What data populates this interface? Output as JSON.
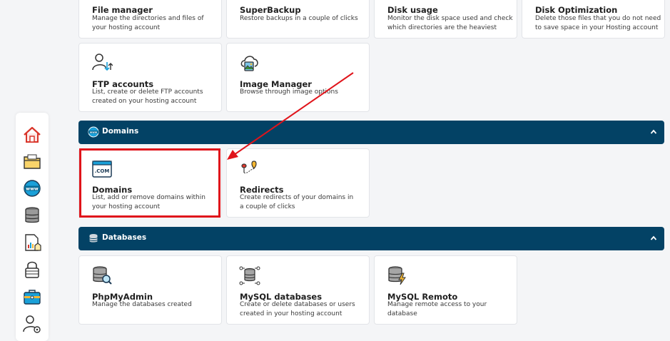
{
  "top_row": [
    {
      "title": "File manager",
      "desc": "Manage the directories and files of your hosting account",
      "icon": "folder-icon"
    },
    {
      "title": "SuperBackup",
      "desc": "Restore backups in a couple of clicks",
      "icon": "backup-icon"
    },
    {
      "title": "Disk usage",
      "desc": "Monitor the disk space used and check which directories are the heaviest",
      "icon": "disk-icon"
    },
    {
      "title": "Disk Optimization",
      "desc": "Delete those files that you do not need to save space in your Hosting account",
      "icon": "optimize-icon"
    }
  ],
  "files_row2": [
    {
      "title": "FTP accounts",
      "desc": "List, create or delete FTP accounts created on your hosting account",
      "icon": "ftp-user-icon"
    },
    {
      "title": "Image Manager",
      "desc": "Browse through image options",
      "icon": "image-cloud-icon"
    }
  ],
  "sections": {
    "domains": {
      "title": "Domains",
      "icon": "www-globe-icon"
    },
    "databases": {
      "title": "Databases",
      "icon": "database-icon"
    }
  },
  "domains_cards": [
    {
      "title": "Domains",
      "desc": "List, add or remove domains within your hosting account",
      "icon": "dot-com-browser-icon",
      "icon_text": ".COM"
    },
    {
      "title": "Redirects",
      "desc": "Create redirects of your domains in a couple of clicks",
      "icon": "redirect-pins-icon"
    }
  ],
  "database_cards": [
    {
      "title": "PhpMyAdmin",
      "desc": "Manage the databases created",
      "icon": "database-search-icon"
    },
    {
      "title": "MySQL databases",
      "desc": "Create or delete databases or users created in your hosting account",
      "icon": "database-network-icon"
    },
    {
      "title": "MySQL Remoto",
      "desc": "Manage remote access to your database",
      "icon": "database-bolt-icon"
    }
  ],
  "sidebar": [
    {
      "icon": "home-icon"
    },
    {
      "icon": "folder-icon"
    },
    {
      "icon": "www-globe-icon",
      "text": "www"
    },
    {
      "icon": "database-icon"
    },
    {
      "icon": "file-chart-icon"
    },
    {
      "icon": "lock-icon"
    },
    {
      "icon": "toolbox-icon"
    },
    {
      "icon": "user-settings-icon"
    }
  ],
  "colors": {
    "section_bar": "#034265",
    "highlight": "#e0141b",
    "accent_blue": "#1aa0d8",
    "accent_orange": "#f5b731"
  }
}
